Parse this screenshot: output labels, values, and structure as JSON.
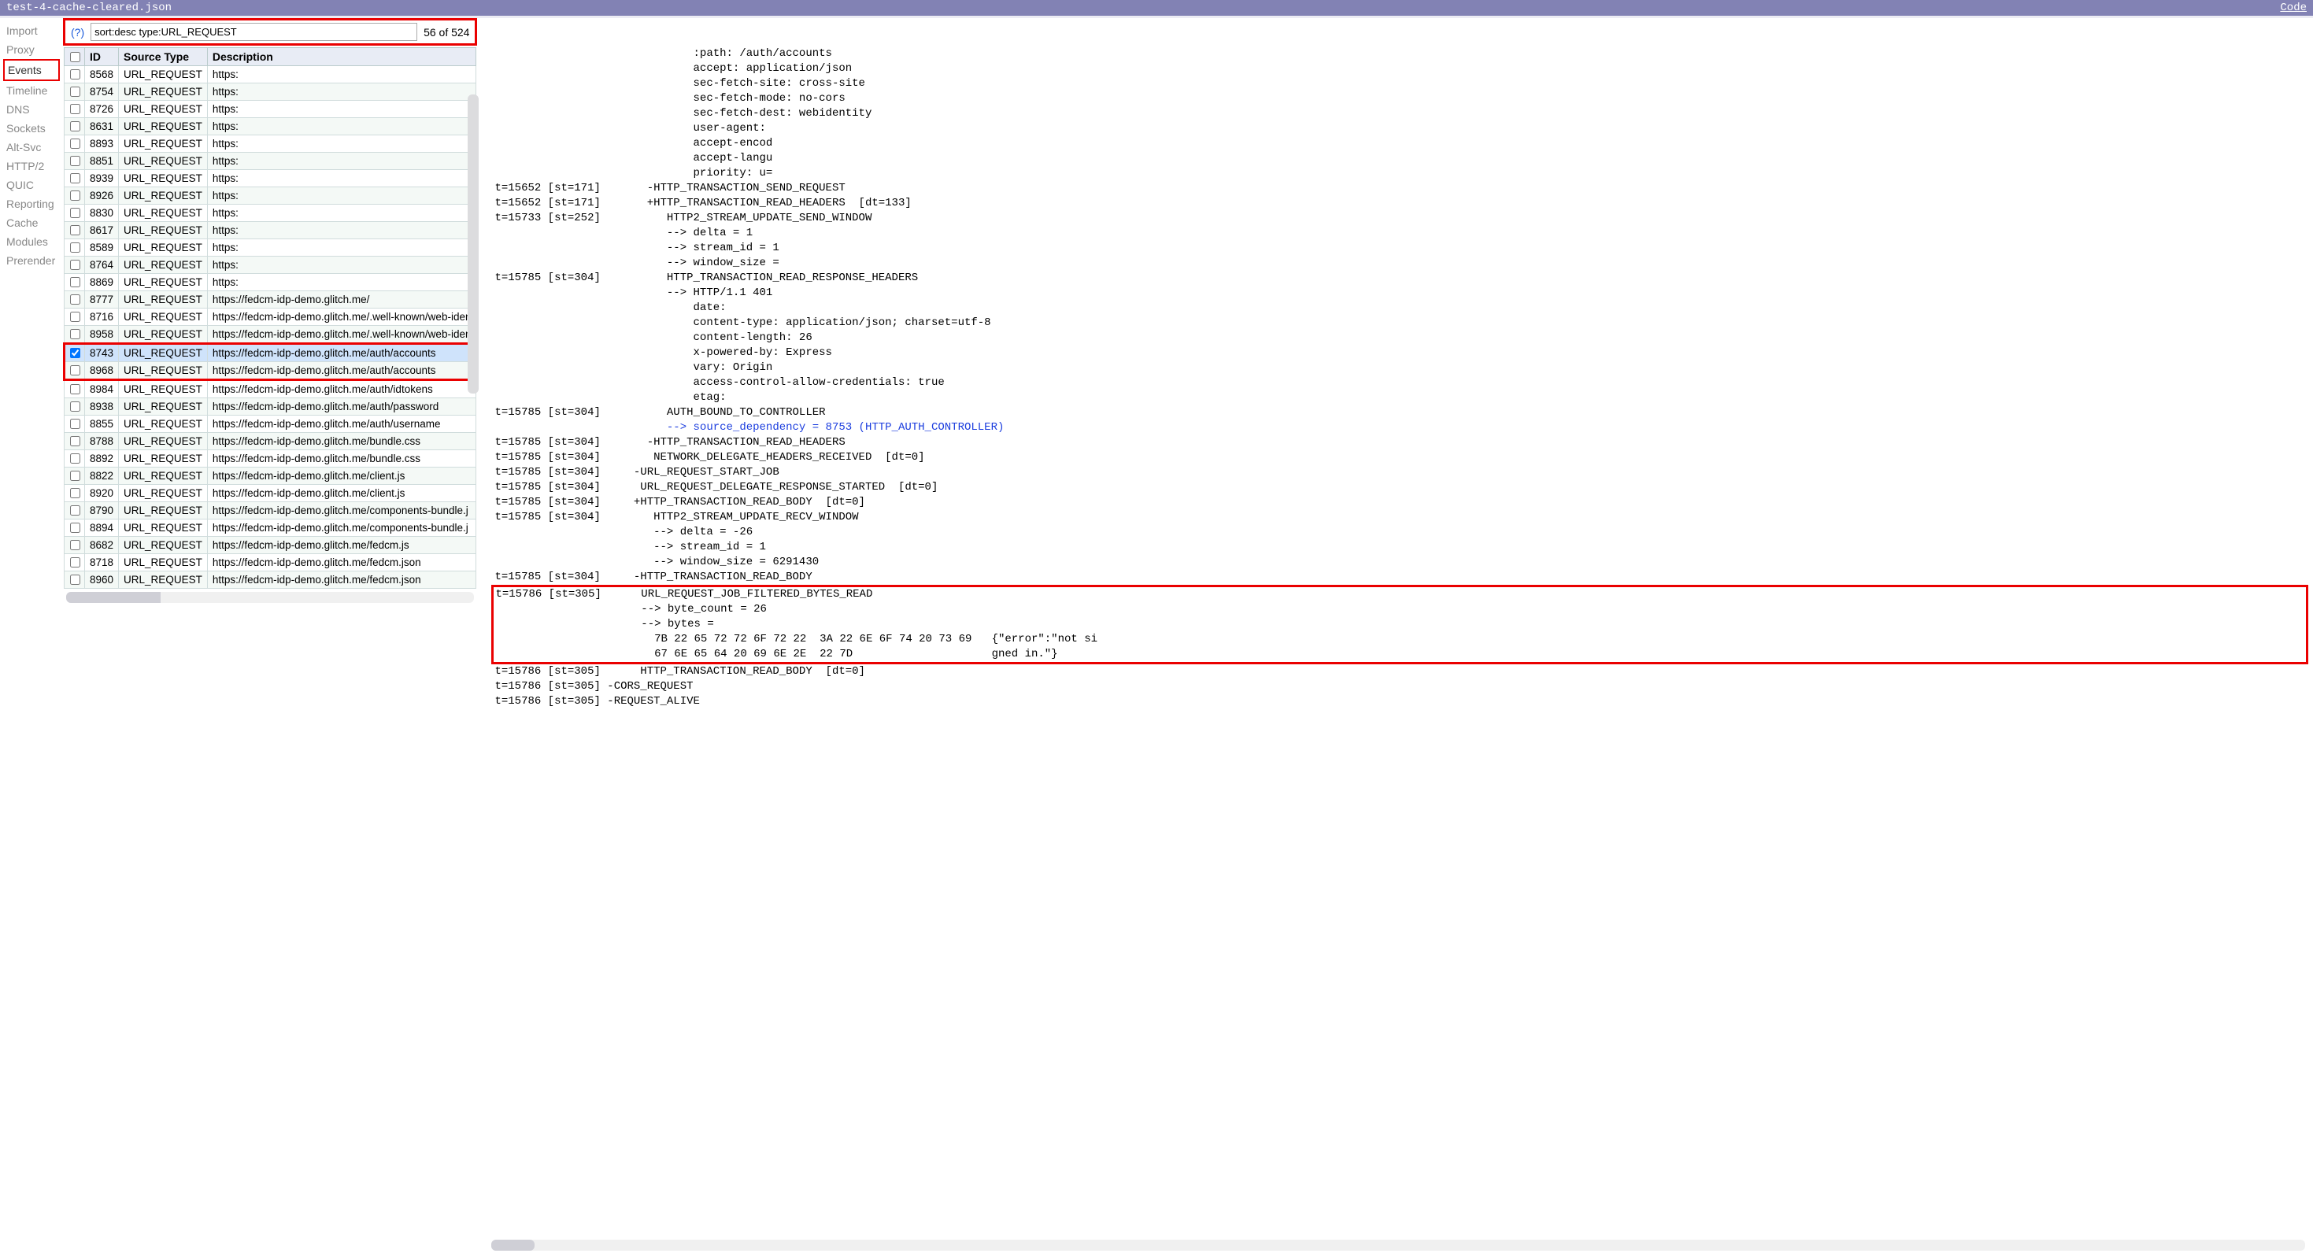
{
  "titlebar": {
    "filename": "test-4-cache-cleared.json",
    "code_link": "Code"
  },
  "sidebar": {
    "items": [
      {
        "label": "Import",
        "selected": false
      },
      {
        "label": "Proxy",
        "selected": false
      },
      {
        "label": "Events",
        "selected": true
      },
      {
        "label": "Timeline",
        "selected": false
      },
      {
        "label": "DNS",
        "selected": false
      },
      {
        "label": "Sockets",
        "selected": false
      },
      {
        "label": "Alt-Svc",
        "selected": false
      },
      {
        "label": "HTTP/2",
        "selected": false
      },
      {
        "label": "QUIC",
        "selected": false
      },
      {
        "label": "Reporting",
        "selected": false
      },
      {
        "label": "Cache",
        "selected": false
      },
      {
        "label": "Modules",
        "selected": false
      },
      {
        "label": "Prerender",
        "selected": false
      }
    ]
  },
  "filter": {
    "help": "(?)",
    "query": "sort:desc type:URL_REQUEST",
    "count": "56 of 524"
  },
  "table": {
    "headers": [
      "",
      "ID",
      "Source Type",
      "Description"
    ],
    "rows": [
      {
        "id": "8568",
        "type": "URL_REQUEST",
        "desc": "https:"
      },
      {
        "id": "8754",
        "type": "URL_REQUEST",
        "desc": "https:"
      },
      {
        "id": "8726",
        "type": "URL_REQUEST",
        "desc": "https:"
      },
      {
        "id": "8631",
        "type": "URL_REQUEST",
        "desc": "https:"
      },
      {
        "id": "8893",
        "type": "URL_REQUEST",
        "desc": "https:"
      },
      {
        "id": "8851",
        "type": "URL_REQUEST",
        "desc": "https:"
      },
      {
        "id": "8939",
        "type": "URL_REQUEST",
        "desc": "https:"
      },
      {
        "id": "8926",
        "type": "URL_REQUEST",
        "desc": "https:"
      },
      {
        "id": "8830",
        "type": "URL_REQUEST",
        "desc": "https:"
      },
      {
        "id": "8617",
        "type": "URL_REQUEST",
        "desc": "https:"
      },
      {
        "id": "8589",
        "type": "URL_REQUEST",
        "desc": "https:"
      },
      {
        "id": "8764",
        "type": "URL_REQUEST",
        "desc": "https:"
      },
      {
        "id": "8869",
        "type": "URL_REQUEST",
        "desc": "https:"
      },
      {
        "id": "8777",
        "type": "URL_REQUEST",
        "desc": "https://fedcm-idp-demo.glitch.me/"
      },
      {
        "id": "8716",
        "type": "URL_REQUEST",
        "desc": "https://fedcm-idp-demo.glitch.me/.well-known/web-iden"
      },
      {
        "id": "8958",
        "type": "URL_REQUEST",
        "desc": "https://fedcm-idp-demo.glitch.me/.well-known/web-iden"
      },
      {
        "id": "8743",
        "type": "URL_REQUEST",
        "desc": "https://fedcm-idp-demo.glitch.me/auth/accounts",
        "selected": true,
        "checked": true,
        "hilite": true
      },
      {
        "id": "8968",
        "type": "URL_REQUEST",
        "desc": "https://fedcm-idp-demo.glitch.me/auth/accounts",
        "hilite": true
      },
      {
        "id": "8984",
        "type": "URL_REQUEST",
        "desc": "https://fedcm-idp-demo.glitch.me/auth/idtokens"
      },
      {
        "id": "8938",
        "type": "URL_REQUEST",
        "desc": "https://fedcm-idp-demo.glitch.me/auth/password"
      },
      {
        "id": "8855",
        "type": "URL_REQUEST",
        "desc": "https://fedcm-idp-demo.glitch.me/auth/username"
      },
      {
        "id": "8788",
        "type": "URL_REQUEST",
        "desc": "https://fedcm-idp-demo.glitch.me/bundle.css"
      },
      {
        "id": "8892",
        "type": "URL_REQUEST",
        "desc": "https://fedcm-idp-demo.glitch.me/bundle.css"
      },
      {
        "id": "8822",
        "type": "URL_REQUEST",
        "desc": "https://fedcm-idp-demo.glitch.me/client.js"
      },
      {
        "id": "8920",
        "type": "URL_REQUEST",
        "desc": "https://fedcm-idp-demo.glitch.me/client.js"
      },
      {
        "id": "8790",
        "type": "URL_REQUEST",
        "desc": "https://fedcm-idp-demo.glitch.me/components-bundle.j"
      },
      {
        "id": "8894",
        "type": "URL_REQUEST",
        "desc": "https://fedcm-idp-demo.glitch.me/components-bundle.j"
      },
      {
        "id": "8682",
        "type": "URL_REQUEST",
        "desc": "https://fedcm-idp-demo.glitch.me/fedcm.js"
      },
      {
        "id": "8718",
        "type": "URL_REQUEST",
        "desc": "https://fedcm-idp-demo.glitch.me/fedcm.json"
      },
      {
        "id": "8960",
        "type": "URL_REQUEST",
        "desc": "https://fedcm-idp-demo.glitch.me/fedcm.json"
      }
    ]
  },
  "details": {
    "pre_lines": [
      "                              :path: /auth/accounts",
      "                              accept: application/json",
      "                              sec-fetch-site: cross-site",
      "                              sec-fetch-mode: no-cors",
      "                              sec-fetch-dest: webidentity",
      "                              user-agent:",
      "                              accept-encod",
      "                              accept-langu",
      "                              priority: u=",
      "t=15652 [st=171]       -HTTP_TRANSACTION_SEND_REQUEST",
      "t=15652 [st=171]       +HTTP_TRANSACTION_READ_HEADERS  [dt=133]",
      "t=15733 [st=252]          HTTP2_STREAM_UPDATE_SEND_WINDOW",
      "                          --> delta = 1",
      "                          --> stream_id = 1",
      "                          --> window_size =",
      "t=15785 [st=304]          HTTP_TRANSACTION_READ_RESPONSE_HEADERS",
      "                          --> HTTP/1.1 401",
      "                              date:",
      "                              content-type: application/json; charset=utf-8",
      "                              content-length: 26",
      "                              x-powered-by: Express",
      "                              vary: Origin",
      "                              access-control-allow-credentials: true",
      "                              etag:",
      "t=15785 [st=304]          AUTH_BOUND_TO_CONTROLLER"
    ],
    "link_line": "                          --> source_dependency = 8753 (HTTP_AUTH_CONTROLLER)",
    "mid_lines": [
      "t=15785 [st=304]       -HTTP_TRANSACTION_READ_HEADERS",
      "t=15785 [st=304]        NETWORK_DELEGATE_HEADERS_RECEIVED  [dt=0]",
      "t=15785 [st=304]     -URL_REQUEST_START_JOB",
      "t=15785 [st=304]      URL_REQUEST_DELEGATE_RESPONSE_STARTED  [dt=0]",
      "t=15785 [st=304]     +HTTP_TRANSACTION_READ_BODY  [dt=0]",
      "t=15785 [st=304]        HTTP2_STREAM_UPDATE_RECV_WINDOW",
      "                        --> delta = -26",
      "                        --> stream_id = 1",
      "                        --> window_size = 6291430",
      "t=15785 [st=304]     -HTTP_TRANSACTION_READ_BODY"
    ],
    "hilite_lines": [
      "t=15786 [st=305]      URL_REQUEST_JOB_FILTERED_BYTES_READ",
      "                      --> byte_count = 26",
      "                      --> bytes =",
      "                        7B 22 65 72 72 6F 72 22  3A 22 6E 6F 74 20 73 69   {\"error\":\"not si",
      "                        67 6E 65 64 20 69 6E 2E  22 7D                     gned in.\"}"
    ],
    "post_lines": [
      "t=15786 [st=305]      HTTP_TRANSACTION_READ_BODY  [dt=0]",
      "t=15786 [st=305] -CORS_REQUEST",
      "t=15786 [st=305] -REQUEST_ALIVE"
    ]
  }
}
